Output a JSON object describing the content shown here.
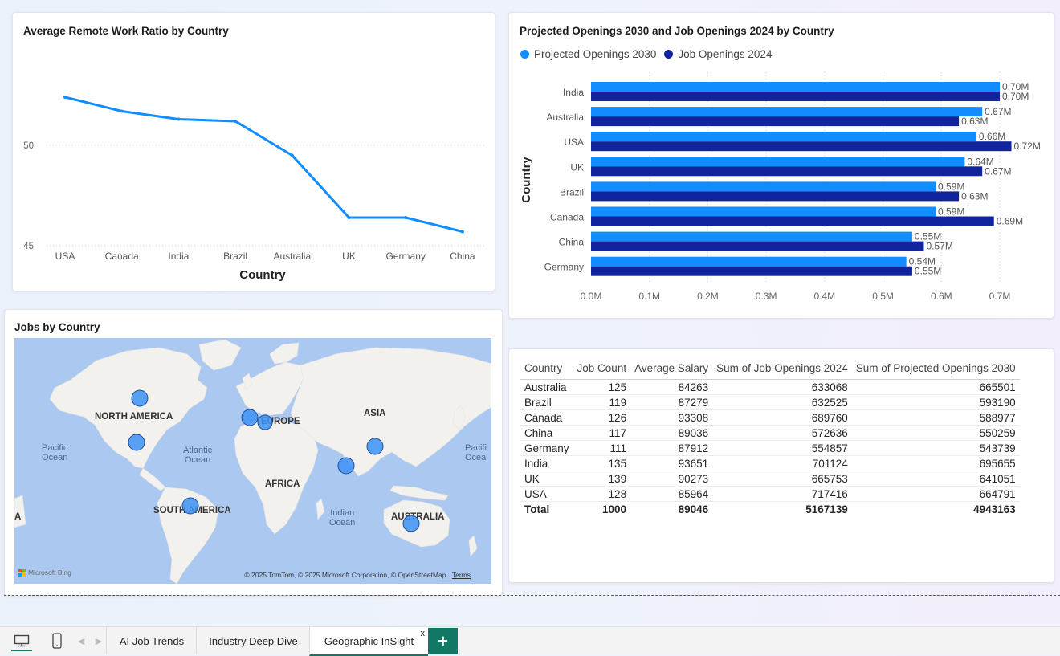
{
  "line_chart": {
    "title": "Average Remote Work Ratio by Country",
    "xlabel": "Country",
    "chart_data": {
      "type": "line",
      "categories": [
        "USA",
        "Canada",
        "India",
        "Brazil",
        "Australia",
        "UK",
        "Germany",
        "China"
      ],
      "values": [
        52.4,
        51.7,
        51.3,
        51.2,
        49.5,
        46.4,
        46.4,
        45.7
      ],
      "ylim": [
        44,
        54.2
      ],
      "yticks": [
        45,
        50
      ],
      "xlabel": "Country",
      "ylabel": "",
      "grid": true,
      "color": "#118dff"
    }
  },
  "bar_chart": {
    "title": "Projected Openings 2030 and Job Openings 2024 by Country",
    "legend": [
      "Projected Openings 2030",
      "Job Openings 2024"
    ],
    "colors": [
      "#118dff",
      "#12239e"
    ],
    "chart_data": {
      "type": "bar",
      "orientation": "horizontal",
      "categories": [
        "India",
        "Australia",
        "USA",
        "UK",
        "Brazil",
        "Canada",
        "China",
        "Germany"
      ],
      "series": [
        {
          "name": "Projected Openings 2030",
          "values": [
            0.7,
            0.67,
            0.66,
            0.64,
            0.59,
            0.59,
            0.55,
            0.54
          ],
          "labels": [
            "0.70M",
            "0.67M",
            "0.66M",
            "0.64M",
            "0.59M",
            "0.59M",
            "0.55M",
            "0.54M"
          ]
        },
        {
          "name": "Job Openings 2024",
          "values": [
            0.7,
            0.63,
            0.72,
            0.67,
            0.63,
            0.69,
            0.57,
            0.55
          ],
          "labels": [
            "0.70M",
            "0.63M",
            "0.72M",
            "0.67M",
            "0.63M",
            "0.69M",
            "0.57M",
            "0.55M"
          ]
        }
      ],
      "xticks": [
        "0.0M",
        "0.1M",
        "0.2M",
        "0.3M",
        "0.4M",
        "0.5M",
        "0.6M",
        "0.7M"
      ],
      "xlim": [
        0,
        0.7
      ],
      "ylabel": "Country",
      "legend_position": "top-left"
    }
  },
  "map": {
    "title": "Jobs by Country",
    "labels": [
      "NORTH AMERICA",
      "EUROPE",
      "ASIA",
      "AFRICA",
      "SOUTH AMERICA",
      "AUSTRALIA",
      "A",
      "Pacific",
      "Ocean",
      "Atlantic",
      "Ocean",
      "Pacifi",
      "Ocea",
      "Indian",
      "Ocean"
    ],
    "attribution": "© 2025 TomTom, © 2025 Microsoft Corporation, © OpenStreetMap",
    "terms": "Terms",
    "logo": "Microsoft Bing"
  },
  "table": {
    "columns": [
      "Country",
      "Job Count",
      "Average Salary",
      "Sum of Job Openings 2024",
      "Sum of Projected Openings 2030"
    ],
    "rows": [
      [
        "Australia",
        "125",
        "84263",
        "633068",
        "665501"
      ],
      [
        "Brazil",
        "119",
        "87279",
        "632525",
        "593190"
      ],
      [
        "Canada",
        "126",
        "93308",
        "689760",
        "588977"
      ],
      [
        "China",
        "117",
        "89036",
        "572636",
        "550259"
      ],
      [
        "Germany",
        "111",
        "87912",
        "554857",
        "543739"
      ],
      [
        "India",
        "135",
        "93651",
        "701124",
        "695655"
      ],
      [
        "UK",
        "139",
        "90273",
        "665753",
        "641051"
      ],
      [
        "USA",
        "128",
        "85964",
        "717416",
        "664791"
      ]
    ],
    "total": [
      "Total",
      "1000",
      "89046",
      "5167139",
      "4943163"
    ]
  },
  "tabs": {
    "items": [
      "AI Job Trends",
      "Industry Deep Dive",
      "Geographic InSight"
    ],
    "active": "Geographic InSight",
    "close": "x",
    "add": "+"
  }
}
